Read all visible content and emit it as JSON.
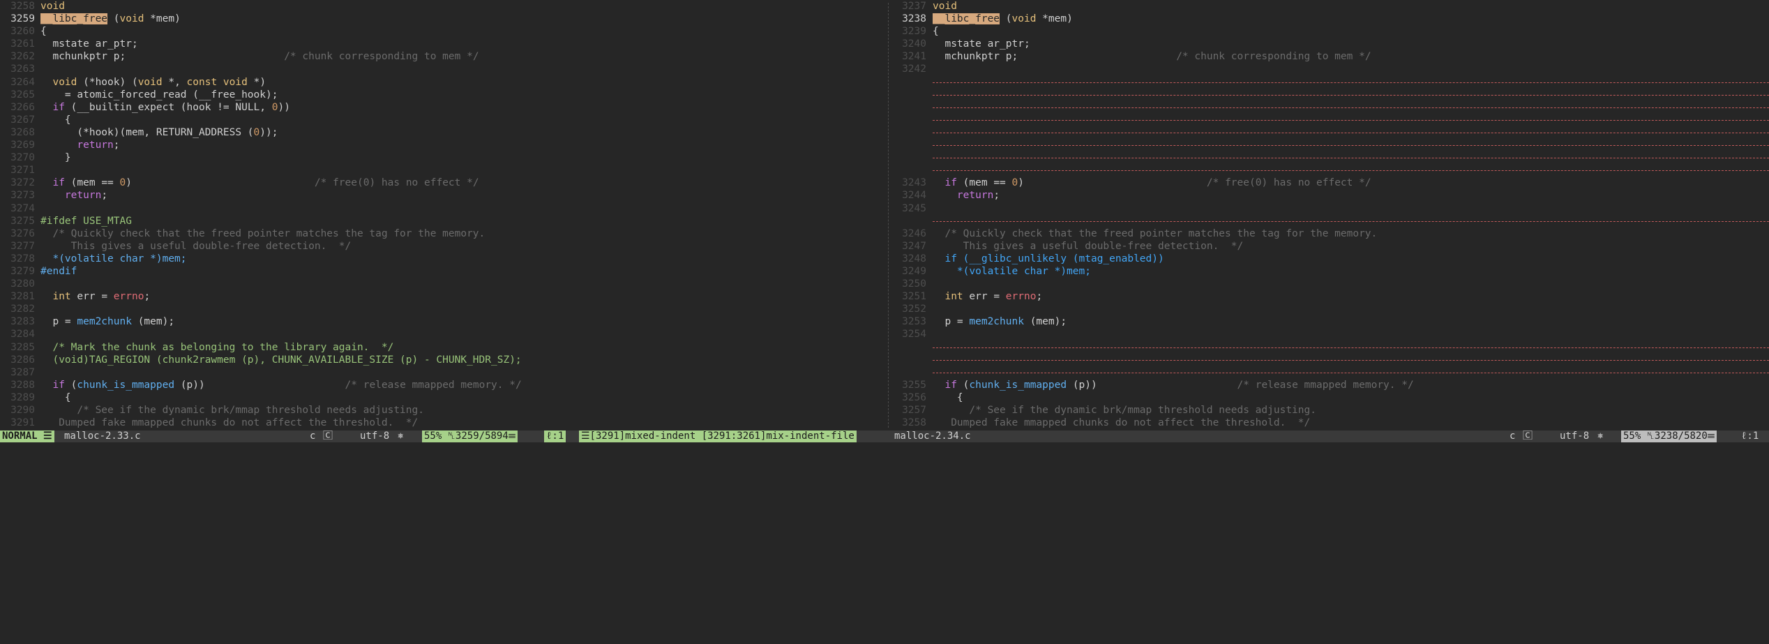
{
  "left": {
    "lines": [
      {
        "n": "3258",
        "segs": [
          [
            "t-type",
            "void"
          ]
        ]
      },
      {
        "n": "3259",
        "cur": true,
        "segs": [
          [
            "t-hl",
            "__libc_free"
          ],
          [
            "t-default",
            " ("
          ],
          [
            "t-type",
            "void"
          ],
          [
            "t-default",
            " *mem)"
          ]
        ]
      },
      {
        "n": "3260",
        "segs": [
          [
            "t-default",
            "{"
          ]
        ]
      },
      {
        "n": "3261",
        "segs": [
          [
            "t-default",
            "  mstate ar_ptr;"
          ]
        ]
      },
      {
        "n": "3262",
        "segs": [
          [
            "t-default",
            "  mchunkptr p;                          "
          ],
          [
            "t-comment",
            "/* chunk corresponding to mem */"
          ]
        ]
      },
      {
        "n": "3263",
        "segs": []
      },
      {
        "n": "3264",
        "segs": [
          [
            "t-default",
            "  "
          ],
          [
            "t-type",
            "void"
          ],
          [
            "t-default",
            " (*hook) ("
          ],
          [
            "t-type",
            "void"
          ],
          [
            "t-default",
            " *, "
          ],
          [
            "t-type",
            "const void"
          ],
          [
            "t-default",
            " *)"
          ]
        ]
      },
      {
        "n": "3265",
        "segs": [
          [
            "t-default",
            "    = atomic_forced_read (__free_hook);"
          ]
        ]
      },
      {
        "n": "3266",
        "segs": [
          [
            "t-default",
            "  "
          ],
          [
            "t-kw",
            "if"
          ],
          [
            "t-default",
            " (__builtin_expect (hook != NULL, "
          ],
          [
            "t-num",
            "0"
          ],
          [
            "t-default",
            "))"
          ]
        ]
      },
      {
        "n": "3267",
        "segs": [
          [
            "t-default",
            "    {"
          ]
        ]
      },
      {
        "n": "3268",
        "segs": [
          [
            "t-default",
            "      (*hook)(mem, RETURN_ADDRESS ("
          ],
          [
            "t-num",
            "0"
          ],
          [
            "t-default",
            "));"
          ]
        ]
      },
      {
        "n": "3269",
        "segs": [
          [
            "t-default",
            "      "
          ],
          [
            "t-kw",
            "return"
          ],
          [
            "t-default",
            ";"
          ]
        ]
      },
      {
        "n": "3270",
        "segs": [
          [
            "t-default",
            "    }"
          ]
        ]
      },
      {
        "n": "3271",
        "segs": []
      },
      {
        "n": "3272",
        "segs": [
          [
            "t-default",
            "  "
          ],
          [
            "t-kw",
            "if"
          ],
          [
            "t-default",
            " (mem == "
          ],
          [
            "t-num",
            "0"
          ],
          [
            "t-default",
            ")                              "
          ],
          [
            "t-comment",
            "/* free(0) has no effect */"
          ]
        ]
      },
      {
        "n": "3273",
        "segs": [
          [
            "t-default",
            "    "
          ],
          [
            "t-kw",
            "return"
          ],
          [
            "t-default",
            ";"
          ]
        ]
      },
      {
        "n": "3274",
        "segs": []
      },
      {
        "n": "3275",
        "segs": [
          [
            "t-macro",
            "#ifdef USE_MTAG"
          ]
        ]
      },
      {
        "n": "3276",
        "segs": [
          [
            "t-comment",
            "  /* Quickly check that the freed pointer matches the tag for the memory."
          ]
        ]
      },
      {
        "n": "3277",
        "segs": [
          [
            "t-comment",
            "     This gives a useful double-free detection.  */"
          ]
        ]
      },
      {
        "n": "3278",
        "segs": [
          [
            "t-pre",
            "  *(volatile char *)mem;"
          ]
        ]
      },
      {
        "n": "3279",
        "segs": [
          [
            "t-pre",
            "#endif"
          ]
        ]
      },
      {
        "n": "3280",
        "segs": []
      },
      {
        "n": "3281",
        "segs": [
          [
            "t-default",
            "  "
          ],
          [
            "t-type",
            "int"
          ],
          [
            "t-default",
            " err = "
          ],
          [
            "t-errno",
            "errno"
          ],
          [
            "t-default",
            ";"
          ]
        ]
      },
      {
        "n": "3282",
        "segs": []
      },
      {
        "n": "3283",
        "segs": [
          [
            "t-default",
            "  p = "
          ],
          [
            "t-fn",
            "mem2chunk"
          ],
          [
            "t-default",
            " (mem);"
          ]
        ]
      },
      {
        "n": "3284",
        "segs": []
      },
      {
        "n": "3285",
        "segs": [
          [
            "t-macro",
            "  /* Mark the chunk as belonging to the library again.  */"
          ]
        ]
      },
      {
        "n": "3286",
        "segs": [
          [
            "t-macro",
            "  (void)TAG_REGION (chunk2rawmem (p), CHUNK_AVAILABLE_SIZE (p) - CHUNK_HDR_SZ);"
          ]
        ]
      },
      {
        "n": "3287",
        "segs": []
      },
      {
        "n": "3288",
        "segs": [
          [
            "t-default",
            "  "
          ],
          [
            "t-kw",
            "if"
          ],
          [
            "t-default",
            " ("
          ],
          [
            "t-fn",
            "chunk_is_mmapped"
          ],
          [
            "t-default",
            " (p))                       "
          ],
          [
            "t-comment",
            "/* release mmapped memory. */"
          ]
        ]
      },
      {
        "n": "3289",
        "segs": [
          [
            "t-default",
            "    {"
          ]
        ]
      },
      {
        "n": "3290",
        "segs": [
          [
            "t-comment",
            "      /* See if the dynamic brk/mmap threshold needs adjusting."
          ]
        ]
      },
      {
        "n": "3291",
        "segs": [
          [
            "t-comment",
            "   Dumped fake mmapped chunks do not affect the threshold.  */"
          ]
        ]
      }
    ]
  },
  "right": {
    "lines": [
      {
        "n": "3237",
        "segs": [
          [
            "t-type",
            "void"
          ]
        ]
      },
      {
        "n": "3238",
        "cur": true,
        "segs": [
          [
            "t-hl",
            "__libc_free"
          ],
          [
            "t-default",
            " ("
          ],
          [
            "t-type",
            "void"
          ],
          [
            "t-default",
            " *mem)"
          ]
        ]
      },
      {
        "n": "3239",
        "segs": [
          [
            "t-default",
            "{"
          ]
        ]
      },
      {
        "n": "3240",
        "segs": [
          [
            "t-default",
            "  mstate ar_ptr;"
          ]
        ]
      },
      {
        "n": "3241",
        "segs": [
          [
            "t-default",
            "  mchunkptr p;                          "
          ],
          [
            "t-comment",
            "/* chunk corresponding to mem */"
          ]
        ]
      },
      {
        "n": "3242",
        "segs": []
      },
      {
        "filler": true
      },
      {
        "filler": true
      },
      {
        "filler": true
      },
      {
        "filler": true
      },
      {
        "filler": true
      },
      {
        "filler": true
      },
      {
        "filler": true
      },
      {
        "filler": true
      },
      {
        "n": "3243",
        "segs": [
          [
            "t-default",
            "  "
          ],
          [
            "t-kw",
            "if"
          ],
          [
            "t-default",
            " (mem == "
          ],
          [
            "t-num",
            "0"
          ],
          [
            "t-default",
            ")                              "
          ],
          [
            "t-comment",
            "/* free(0) has no effect */"
          ]
        ]
      },
      {
        "n": "3244",
        "segs": [
          [
            "t-default",
            "    "
          ],
          [
            "t-kw",
            "return"
          ],
          [
            "t-default",
            ";"
          ]
        ]
      },
      {
        "n": "3245",
        "segs": []
      },
      {
        "filler": true
      },
      {
        "n": "3246",
        "segs": [
          [
            "t-comment",
            "  /* Quickly check that the freed pointer matches the tag for the memory."
          ]
        ]
      },
      {
        "n": "3247",
        "segs": [
          [
            "t-comment",
            "     This gives a useful double-free detection.  */"
          ]
        ]
      },
      {
        "n": "3248",
        "segs": [
          [
            "t-diff",
            "  if (__glibc_unlikely (mtag_enabled))"
          ]
        ]
      },
      {
        "n": "3249",
        "segs": [
          [
            "t-diff",
            "    *(volatile char *)mem;"
          ]
        ]
      },
      {
        "n": "3250",
        "segs": []
      },
      {
        "n": "3251",
        "segs": [
          [
            "t-default",
            "  "
          ],
          [
            "t-type",
            "int"
          ],
          [
            "t-default",
            " err = "
          ],
          [
            "t-errno",
            "errno"
          ],
          [
            "t-default",
            ";"
          ]
        ]
      },
      {
        "n": "3252",
        "segs": []
      },
      {
        "n": "3253",
        "segs": [
          [
            "t-default",
            "  p = "
          ],
          [
            "t-fn",
            "mem2chunk"
          ],
          [
            "t-default",
            " (mem);"
          ]
        ]
      },
      {
        "n": "3254",
        "segs": []
      },
      {
        "filler": true
      },
      {
        "filler": true
      },
      {
        "filler": true
      },
      {
        "n": "3255",
        "segs": [
          [
            "t-default",
            "  "
          ],
          [
            "t-kw",
            "if"
          ],
          [
            "t-default",
            " ("
          ],
          [
            "t-fn",
            "chunk_is_mmapped"
          ],
          [
            "t-default",
            " (p))                       "
          ],
          [
            "t-comment",
            "/* release mmapped memory. */"
          ]
        ]
      },
      {
        "n": "3256",
        "segs": [
          [
            "t-default",
            "    {"
          ]
        ]
      },
      {
        "n": "3257",
        "segs": [
          [
            "t-comment",
            "      /* See if the dynamic brk/mmap threshold needs adjusting."
          ]
        ]
      },
      {
        "n": "3258",
        "segs": [
          [
            "t-comment",
            "   Dumped fake mmapped chunks do not affect the threshold.  */"
          ]
        ]
      }
    ]
  },
  "statusbar": {
    "mode": "NORMAL",
    "mode_icon": "☰",
    "left_file": "malloc-2.33.c",
    "left_ft": "c",
    "left_ft_icon": "🄲",
    "left_enc": "utf-8",
    "left_enc_icon": "⎈",
    "left_percent": "55%",
    "left_pos": "␤3259/5894☰",
    "left_col": "ℓ:1",
    "left_warn": "☰[3291]mixed-indent [3291:3261]mix-indent-file",
    "right_file": "malloc-2.34.c",
    "right_ft": "c",
    "right_ft_icon": "🄲",
    "right_enc": "utf-8",
    "right_enc_icon": "⎈",
    "right_percent": "55%",
    "right_pos": "␤3238/5820☰",
    "right_col": "ℓ:1"
  }
}
